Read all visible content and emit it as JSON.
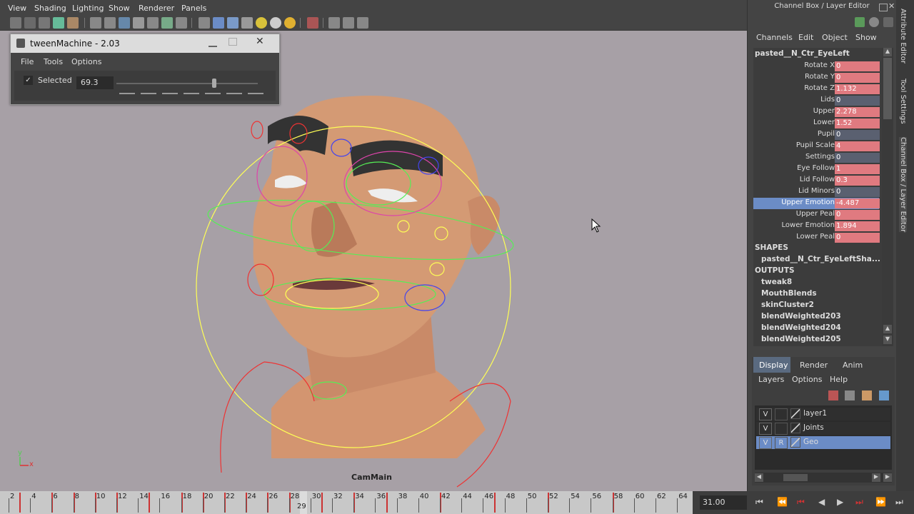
{
  "viewport": {
    "menu": [
      "View",
      "Shading",
      "Lighting",
      "Show",
      "Renderer",
      "Panels"
    ],
    "camera_label": "CamMain",
    "axis": {
      "y": "y",
      "x": "x"
    }
  },
  "tween": {
    "title": "tweenMachine - 2.03",
    "menu": [
      "File",
      "Tools",
      "Options"
    ],
    "selected_label": "Selected",
    "selected_checked": true,
    "value": "69.3",
    "slider_fraction": 0.693
  },
  "channel_box": {
    "panel_title": "Channel Box / Layer Editor",
    "menu": [
      "Channels",
      "Edit",
      "Object",
      "Show"
    ],
    "node": "pasted__N_Ctr_EyeLeft",
    "attributes": [
      {
        "name": "Rotate X",
        "value": "0",
        "color": "#e07a80"
      },
      {
        "name": "Rotate Y",
        "value": "0",
        "color": "#e07a80"
      },
      {
        "name": "Rotate Z",
        "value": "1.132",
        "color": "#e07a80"
      },
      {
        "name": "Lids",
        "value": "0",
        "color": "#5a6070"
      },
      {
        "name": "Upper",
        "value": "2.278",
        "color": "#e07a80"
      },
      {
        "name": "Lower",
        "value": "1.52",
        "color": "#e07a80"
      },
      {
        "name": "Pupil",
        "value": "0",
        "color": "#5a6070"
      },
      {
        "name": "Pupil Scale",
        "value": "4",
        "color": "#e07a80"
      },
      {
        "name": "Settings",
        "value": "0",
        "color": "#5a6070"
      },
      {
        "name": "Eye Follow",
        "value": "1",
        "color": "#e07a80"
      },
      {
        "name": "Lid Follow",
        "value": "0.3",
        "color": "#e07a80"
      },
      {
        "name": "Lid Minors",
        "value": "0",
        "color": "#5a6070"
      },
      {
        "name": "Upper Emotion",
        "value": "-4.487",
        "color": "#e07a80",
        "selected": true
      },
      {
        "name": "Upper Peal",
        "value": "0",
        "color": "#e07a80"
      },
      {
        "name": "Lower Emotion",
        "value": "1.894",
        "color": "#e07a80"
      },
      {
        "name": "Lower Peal",
        "value": "0",
        "color": "#e07a80"
      }
    ],
    "shapes_header": "SHAPES",
    "shape": "pasted__N_Ctr_EyeLeftSha...",
    "outputs_header": "OUTPUTS",
    "outputs": [
      "tweak8",
      "MouthBlends",
      "skinCluster2",
      "blendWeighted203",
      "blendWeighted204",
      "blendWeighted205"
    ]
  },
  "layer_editor": {
    "tabs": [
      "Display",
      "Render",
      "Anim"
    ],
    "menu": [
      "Layers",
      "Options",
      "Help"
    ],
    "layers": [
      {
        "v": "V",
        "r": "",
        "name": "layer1"
      },
      {
        "v": "V",
        "r": "",
        "name": "Joints"
      },
      {
        "v": "V",
        "r": "R",
        "name": "Geo",
        "selected": true
      }
    ]
  },
  "side_tabs": [
    "Attribute Editor",
    "Tool Settings",
    "Channel Box / Layer Editor"
  ],
  "timeline": {
    "tick_labels": [
      "2",
      "4",
      "6",
      "8",
      "10",
      "12",
      "14",
      "16",
      "18",
      "20",
      "22",
      "24",
      "26",
      "28",
      "30",
      "32",
      "34",
      "36",
      "38",
      "40",
      "42",
      "44",
      "46",
      "48",
      "50",
      "52",
      "54",
      "56",
      "58",
      "60",
      "62",
      "64"
    ],
    "current_frame": "29",
    "current_time_field": "31.00",
    "keys": [
      3,
      6,
      8,
      10,
      12,
      15,
      18,
      20,
      22,
      24,
      26,
      28,
      31,
      34,
      37,
      42,
      47,
      52,
      58
    ]
  },
  "colors": {
    "accent": "#6b8cc6",
    "key_red": "#cc3333",
    "attr_keyed": "#e07a80",
    "attr_plain": "#5a6070"
  }
}
